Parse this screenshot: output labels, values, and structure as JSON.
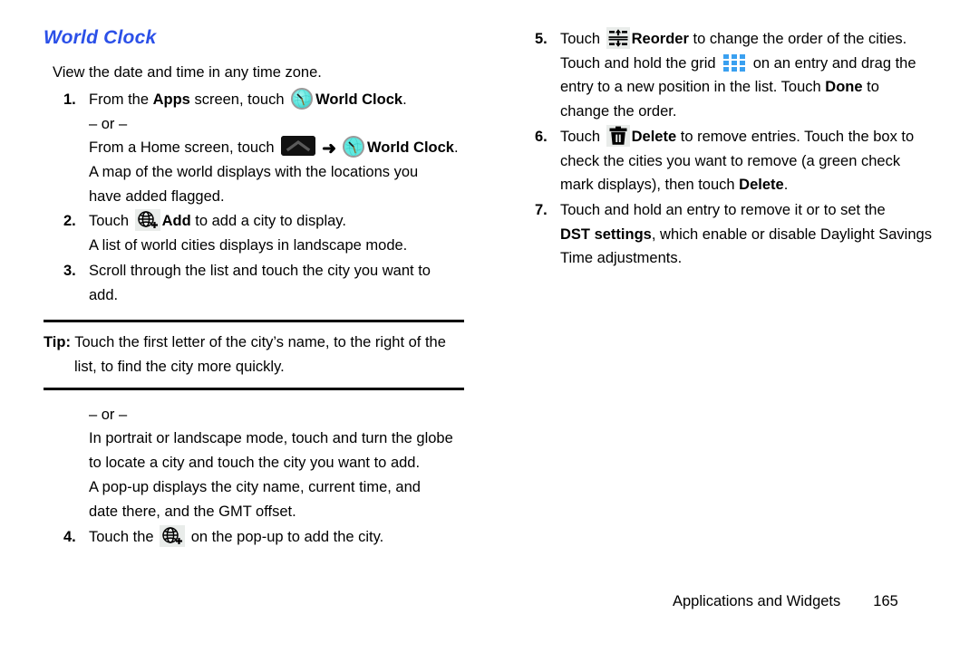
{
  "page": {
    "title": "World Clock",
    "title_color": "#2b50e8",
    "intro": "View the date and time in any time zone."
  },
  "left_column": {
    "steps": [
      {
        "num": "1.",
        "l1_a": "From the ",
        "l1_apps": "Apps",
        "l1_b": " screen, touch ",
        "l1_c": "World Clock",
        "l1_d": ".",
        "or": "– or –",
        "l2_a": "From a Home screen, touch ",
        "l2_arrow": "➜",
        "l2_c": "World Clock",
        "l2_d": ".",
        "l3": "A map of the world displays with the locations you",
        "l4": "have added flagged."
      },
      {
        "num": "2.",
        "l1_a": "Touch ",
        "l1_add": "Add",
        "l1_b": " to add a city to display.",
        "l2": "A list of world cities displays in landscape mode."
      },
      {
        "num": "3.",
        "l1": "Scroll through the list and touch the city you want to",
        "l2": "add."
      }
    ],
    "tip": {
      "label": "Tip:",
      "text": " Touch the first letter of the city’s name, to the right of the list, to find the city more quickly."
    },
    "after_tip": {
      "or": "– or –",
      "p1_l1": "In portrait or landscape mode, touch and turn the globe",
      "p1_l2": "to locate a city and touch the city you want to add.",
      "p2_l1": "A pop-up displays the city name, current time, and",
      "p2_l2": "date there, and the GMT offset."
    },
    "step4": {
      "num": "4.",
      "a": "Touch the ",
      "b": " on the pop-up to add the city."
    }
  },
  "right_column": {
    "steps": [
      {
        "num": "5.",
        "l1_a": "Touch ",
        "l1_reorder": "Reorder",
        "l1_b": " to change the order of the cities.",
        "l2_a": "Touch and hold the grid ",
        "l2_b": " on an entry and drag the",
        "l3_a": "entry to a new position in the list. Touch ",
        "l3_done": "Done",
        "l3_b": " to",
        "l4": "change the order."
      },
      {
        "num": "6.",
        "l1_a": "Touch ",
        "l1_delete": "Delete",
        "l1_b": " to remove entries. Touch the box to",
        "l2": "check the cities you want to remove (a green check",
        "l3_a": "mark displays), then touch ",
        "l3_delete": "Delete",
        "l3_b": "."
      },
      {
        "num": "7.",
        "l1": "Touch and hold an entry to remove it or to set the",
        "l2_dst": "DST settings",
        "l2_b": ", which enable or disable Daylight Savings",
        "l3": "Time adjustments."
      }
    ]
  },
  "footer": {
    "chapter": "Applications and Widgets",
    "page_number": "165"
  },
  "icons": {
    "clock": "world-clock-icon",
    "apps": "apps-chevron-icon",
    "arrow": "right-arrow-icon",
    "globe_plus": "globe-add-icon",
    "reorder": "reorder-icon",
    "grid": "grid-handle-icon",
    "trash": "delete-trash-icon"
  }
}
